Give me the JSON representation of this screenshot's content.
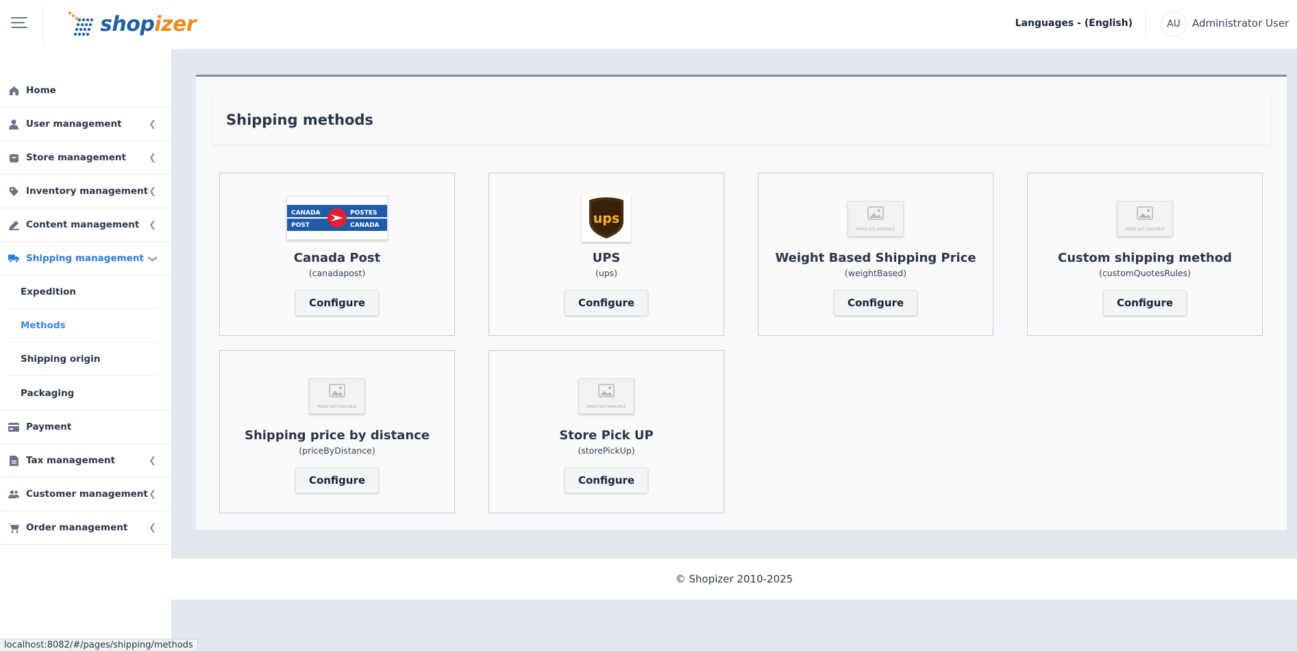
{
  "header": {
    "brand": {
      "text_a": "shop",
      "text_b": "izer"
    },
    "languages_label": "Languages - (English)",
    "avatar_initials": "AU",
    "user_name": "Administrator User"
  },
  "sidebar": {
    "items": [
      {
        "label": "Home",
        "icon": "home-icon",
        "has_chevron": false
      },
      {
        "label": "User management",
        "icon": "user-icon",
        "has_chevron": true
      },
      {
        "label": "Store management",
        "icon": "store-icon",
        "has_chevron": true
      },
      {
        "label": "Inventory management",
        "icon": "tag-icon",
        "has_chevron": true
      },
      {
        "label": "Content management",
        "icon": "pencil-icon",
        "has_chevron": true
      },
      {
        "label": "Shipping management",
        "icon": "truck-icon",
        "has_chevron": true,
        "expanded": true
      },
      {
        "label": "Payment",
        "icon": "credit-card-icon",
        "has_chevron": false
      },
      {
        "label": "Tax management",
        "icon": "document-icon",
        "has_chevron": true
      },
      {
        "label": "Customer management",
        "icon": "users-icon",
        "has_chevron": true
      },
      {
        "label": "Order management",
        "icon": "cart-icon",
        "has_chevron": true
      }
    ],
    "shipping_sub": [
      {
        "label": "Expedition"
      },
      {
        "label": "Methods",
        "active": true
      },
      {
        "label": "Shipping origin"
      },
      {
        "label": "Packaging"
      }
    ]
  },
  "main": {
    "title": "Shipping methods",
    "configure_label": "Configure",
    "methods": [
      {
        "name": "Canada Post",
        "code": "(canadapost)",
        "image": "canada-post-logo"
      },
      {
        "name": "UPS",
        "code": "(ups)",
        "image": "ups-logo"
      },
      {
        "name": "Weight Based Shipping Price",
        "code": "(weightBased)",
        "image": "image-not-available"
      },
      {
        "name": "Custom shipping method",
        "code": "(customQuotesRules)",
        "image": "image-not-available"
      },
      {
        "name": "Shipping price by distance",
        "code": "(priceByDistance)",
        "image": "image-not-available"
      },
      {
        "name": "Store Pick UP",
        "code": "(storePickUp)",
        "image": "image-not-available"
      }
    ],
    "image_not_available_text": "IMAGE NOT AVAILABLE",
    "canada_post_logo_text": [
      "CANADA",
      "POSTES",
      "POST",
      "CANADA"
    ]
  },
  "footer": {
    "text": "© Shopizer 2010-2025"
  },
  "status_bar": {
    "url": "localhost:8082/#/pages/shipping/methods"
  },
  "colors": {
    "accent": "#2a78d8",
    "brand_blue": "#1f5fa8",
    "brand_orange": "#f08a1c"
  }
}
